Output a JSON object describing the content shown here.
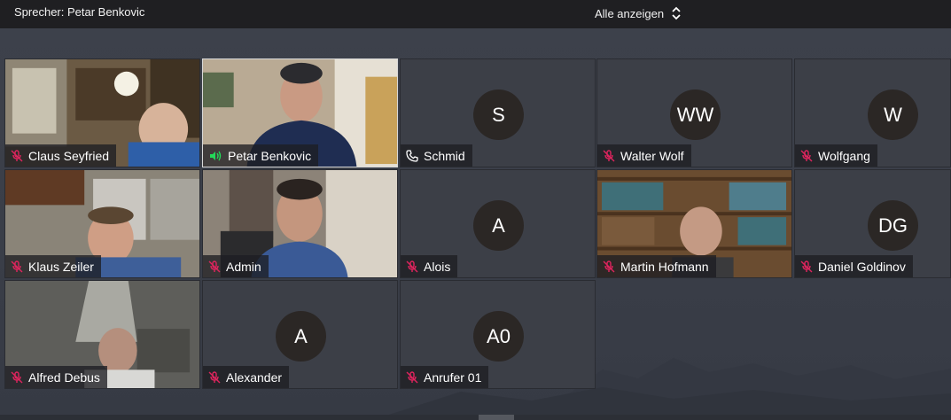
{
  "topbar": {
    "speaker_text": "Sprecher: Petar Benkovic",
    "view_toggle_label": "Alle anzeigen"
  },
  "colors": {
    "muted_mic": "#e0245e",
    "active_speaker": "#23d959",
    "avatar_bg": "#2b2725",
    "label_bg": "#1e1e22"
  },
  "participants": [
    {
      "name": "Claus Seyfried",
      "status": "muted",
      "video": true
    },
    {
      "name": "Petar Benkovic",
      "status": "speaking",
      "video": true
    },
    {
      "name": "Schmid",
      "status": "phone",
      "video": false,
      "initials": "S"
    },
    {
      "name": "Walter Wolf",
      "status": "muted",
      "video": false,
      "initials": "WW"
    },
    {
      "name": "Wolfgang",
      "status": "muted",
      "video": false,
      "initials": "W"
    },
    {
      "name": "Klaus Zeiler",
      "status": "muted",
      "video": true
    },
    {
      "name": "Admin",
      "status": "muted",
      "video": true
    },
    {
      "name": "Alois",
      "status": "muted",
      "video": false,
      "initials": "A"
    },
    {
      "name": "Martin Hofmann",
      "status": "muted",
      "video": true
    },
    {
      "name": "Daniel Goldinov",
      "status": "muted",
      "video": false,
      "initials": "DG"
    },
    {
      "name": "Alfred Debus",
      "status": "muted",
      "video": true
    },
    {
      "name": "Alexander",
      "status": "muted",
      "video": false,
      "initials": "A"
    },
    {
      "name": "Anrufer 01",
      "status": "muted",
      "video": false,
      "initials": "A0"
    }
  ]
}
